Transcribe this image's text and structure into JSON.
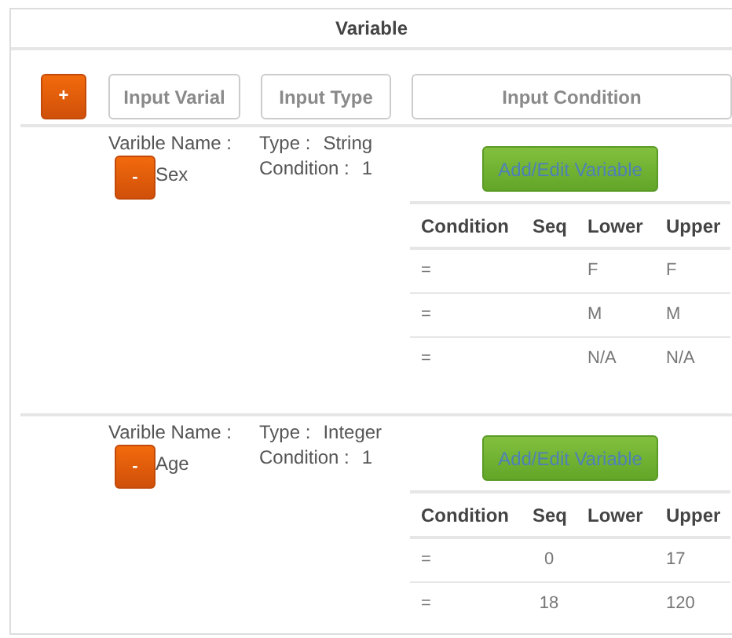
{
  "panel_title": "Variable",
  "add_button": "+",
  "inputs": [
    {
      "placeholder": "Input Varial"
    },
    {
      "placeholder": "Input Type"
    },
    {
      "placeholder": "Input Condition"
    }
  ],
  "variables": [
    {
      "name_label": "Varible Name :",
      "remove_button": "-",
      "name": "Sex",
      "type_label": "Type :",
      "type": "String",
      "condition_label": "Condition :",
      "condition": "1",
      "edit_button": "Add/Edit Variable",
      "table": {
        "columns": [
          "Condition",
          "Seq",
          "Lower",
          "Upper"
        ],
        "rows": [
          {
            "condition": "=",
            "lower": "F",
            "upper": "F"
          },
          {
            "condition": "=",
            "lower": "M",
            "upper": "M"
          },
          {
            "condition": "=",
            "lower": "N/A",
            "upper": "N/A"
          }
        ]
      }
    },
    {
      "name_label": "Varible Name :",
      "remove_button": "-",
      "name": "Age",
      "type_label": "Type :",
      "type": "Integer",
      "condition_label": "Condition :",
      "condition": "1",
      "edit_button": "Add/Edit Variable",
      "table": {
        "columns": [
          "Condition",
          "Seq",
          "Lower",
          "Upper"
        ],
        "rows": [
          {
            "condition": "=",
            "seq": "0",
            "upper": "17"
          },
          {
            "condition": "=",
            "seq": "18",
            "upper": "120"
          }
        ]
      }
    }
  ]
}
